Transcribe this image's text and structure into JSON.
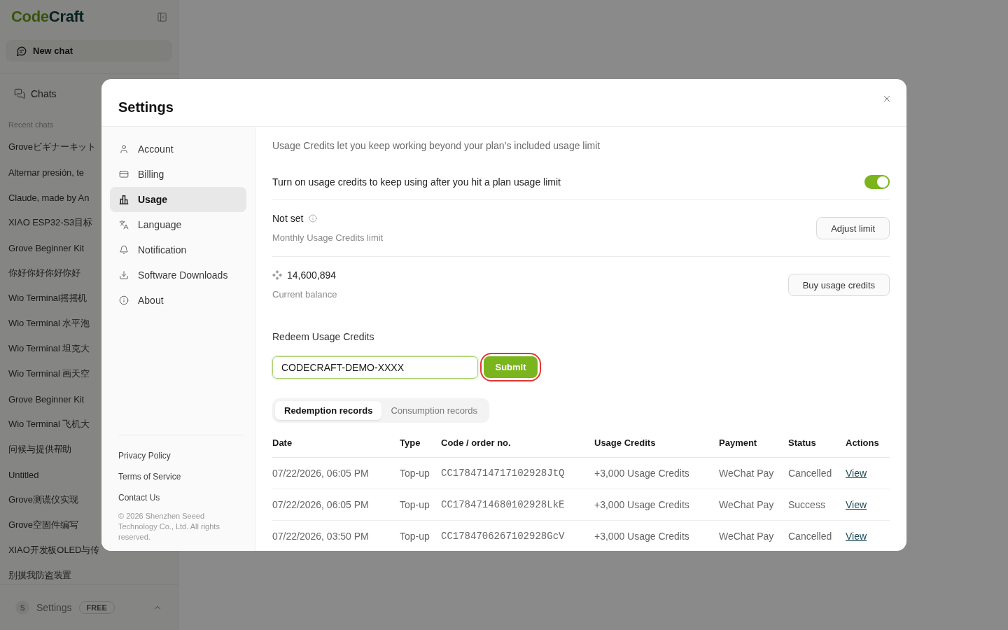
{
  "sidebar": {
    "logo": {
      "parts": [
        "Code",
        "Craft"
      ]
    },
    "new_chat": "New chat",
    "chats": "Chats",
    "recent_heading": "Recent chats",
    "recent_chats": [
      "Groveビギナーキット",
      "Alternar presión, te",
      "Claude, made by An",
      "XIAO ESP32-S3目标",
      "Grove Beginner Kit",
      "你好你好你好你好",
      "Wio Terminal摇摇机",
      "Wio Terminal 水平泡",
      "Wio Terminal 坦克大",
      "Wio Terminal 画天空",
      "Grove Beginner Kit",
      "Wio Terminal 飞机大",
      "问候与提供帮助",
      "Untitled",
      "Grove测谎仪实现",
      "Grove空固件编写",
      "XIAO开发板OLED与传",
      "别摸我防盗装置"
    ],
    "footer": {
      "avatar": "S",
      "label": "Settings",
      "badge": "FREE"
    }
  },
  "modal": {
    "title": "Settings",
    "nav": [
      {
        "label": "Account",
        "selected": false
      },
      {
        "label": "Billing",
        "selected": false
      },
      {
        "label": "Usage",
        "selected": true
      },
      {
        "label": "Language",
        "selected": false
      },
      {
        "label": "Notification",
        "selected": false
      },
      {
        "label": "Software Downloads",
        "selected": false
      },
      {
        "label": "About",
        "selected": false
      }
    ],
    "links": [
      "Privacy Policy",
      "Terms of Service",
      "Contact Us"
    ],
    "copyright": "© 2026 Shenzhen Seeed Technology Co., Ltd. All rights reserved.",
    "usage": {
      "description": "Usage Credits let you keep working beyond your plan’s included usage limit",
      "auto_credits": {
        "label": "Turn on usage credits to keep using after you hit a plan usage limit",
        "on": true
      },
      "limit": {
        "value": "Not set",
        "caption": "Monthly Usage Credits limit",
        "button": "Adjust limit"
      },
      "balance": {
        "value": "14,600,894",
        "caption": "Current balance",
        "button": "Buy usage credits"
      },
      "redeem": {
        "label": "Redeem Usage Credits",
        "value": "CODECRAFT-DEMO-XXXX",
        "submit": {
          "label": "Submit",
          "highlighted": true
        }
      },
      "record_tabs": [
        {
          "label": "Redemption records",
          "selected": true
        },
        {
          "label": "Consumption records",
          "selected": false
        }
      ],
      "table": {
        "columns": [
          "Date",
          "Type",
          "Code / order no.",
          "Usage Credits",
          "Payment",
          "Status",
          "Actions"
        ],
        "rows": [
          {
            "date": "07/22/2026, 06:05 PM",
            "type": "Top-up",
            "code": "CC1784714717102928JtQ",
            "credits": "+3,000 Usage Credits",
            "payment": "WeChat Pay",
            "status": "Cancelled",
            "action": "View"
          },
          {
            "date": "07/22/2026, 06:05 PM",
            "type": "Top-up",
            "code": "CC1784714680102928LkE",
            "credits": "+3,000 Usage Credits",
            "payment": "WeChat Pay",
            "status": "Success",
            "action": "View"
          },
          {
            "date": "07/22/2026, 03:50 PM",
            "type": "Top-up",
            "code": "CC1784706267102928GcV",
            "credits": "+3,000 Usage Credits",
            "payment": "WeChat Pay",
            "status": "Cancelled",
            "action": "View"
          }
        ]
      }
    }
  }
}
